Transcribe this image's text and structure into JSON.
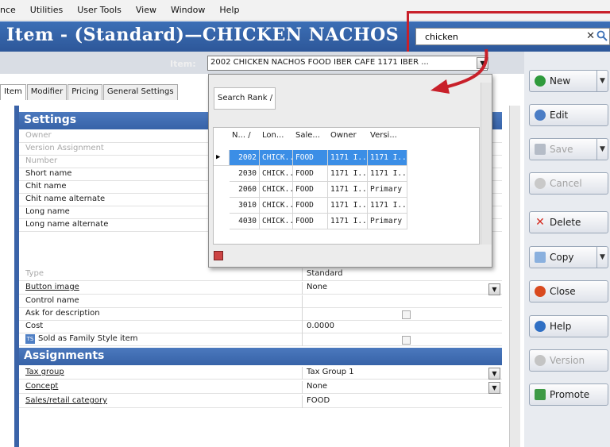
{
  "menu": [
    "nce",
    "Utilities",
    "User Tools",
    "View",
    "Window",
    "Help"
  ],
  "title": "Item - (Standard)—CHICKEN NACHOS",
  "search": {
    "value": "chicken"
  },
  "item_selector": {
    "label": "Item:",
    "value": "2002 CHICKEN NACHOS FOOD IBER CAFE 1171 IBER ..."
  },
  "tabs": [
    "Item",
    "Modifier",
    "Pricing",
    "General Settings"
  ],
  "popup": {
    "search_rank": "Search Rank /",
    "columns": [
      "N... /",
      "Lon...",
      "Sale...",
      "Owner",
      "Versi..."
    ],
    "rows": [
      [
        "2002",
        "CHICK...",
        "FOOD",
        "1171 I...",
        "1171 I..."
      ],
      [
        "2030",
        "CHICK...",
        "FOOD",
        "1171 I...",
        "1171 I..."
      ],
      [
        "2060",
        "CHICK...",
        "FOOD",
        "1171 I...",
        "Primary"
      ],
      [
        "3010",
        "CHICK...",
        "FOOD",
        "1171 I...",
        "1171 I..."
      ],
      [
        "4030",
        "CHICK...",
        "FOOD",
        "1171 I...",
        "Primary"
      ]
    ]
  },
  "sections": {
    "settings": "Settings",
    "assignments": "Assignments"
  },
  "settings_rows": [
    {
      "label": "Owner",
      "value": ""
    },
    {
      "label": "Version Assignment",
      "value": ""
    },
    {
      "label": "Number",
      "value": ""
    },
    {
      "label": "Short name",
      "value": ""
    },
    {
      "label": "Chit name",
      "value": ""
    },
    {
      "label": "Chit name alternate",
      "value": ""
    },
    {
      "label": "Long name",
      "value": ""
    },
    {
      "label": "Long name alternate",
      "value": ""
    },
    {
      "label": "Type",
      "value": "Standard"
    },
    {
      "label": "Button image",
      "value": "None"
    },
    {
      "label": "Control name",
      "value": ""
    },
    {
      "label": "Ask for description",
      "value": ""
    },
    {
      "label": "Cost",
      "value": "0.0000"
    },
    {
      "label": "Sold as Family Style item",
      "value": ""
    }
  ],
  "assignment_rows": [
    {
      "label": "Tax group",
      "value": "Tax Group 1"
    },
    {
      "label": "Concept",
      "value": "None"
    },
    {
      "label": "Sales/retail category",
      "value": "FOOD"
    }
  ],
  "buttons": {
    "new": "New",
    "edit": "Edit",
    "save": "Save",
    "cancel": "Cancel",
    "delete": "Delete",
    "copy": "Copy",
    "close": "Close",
    "help": "Help",
    "version": "Version",
    "promote": "Promote"
  },
  "colors": {
    "title_bar": "#3563aa",
    "selection": "#3b8ee6",
    "highlight": "#c8202a",
    "section": "#4170b6"
  }
}
